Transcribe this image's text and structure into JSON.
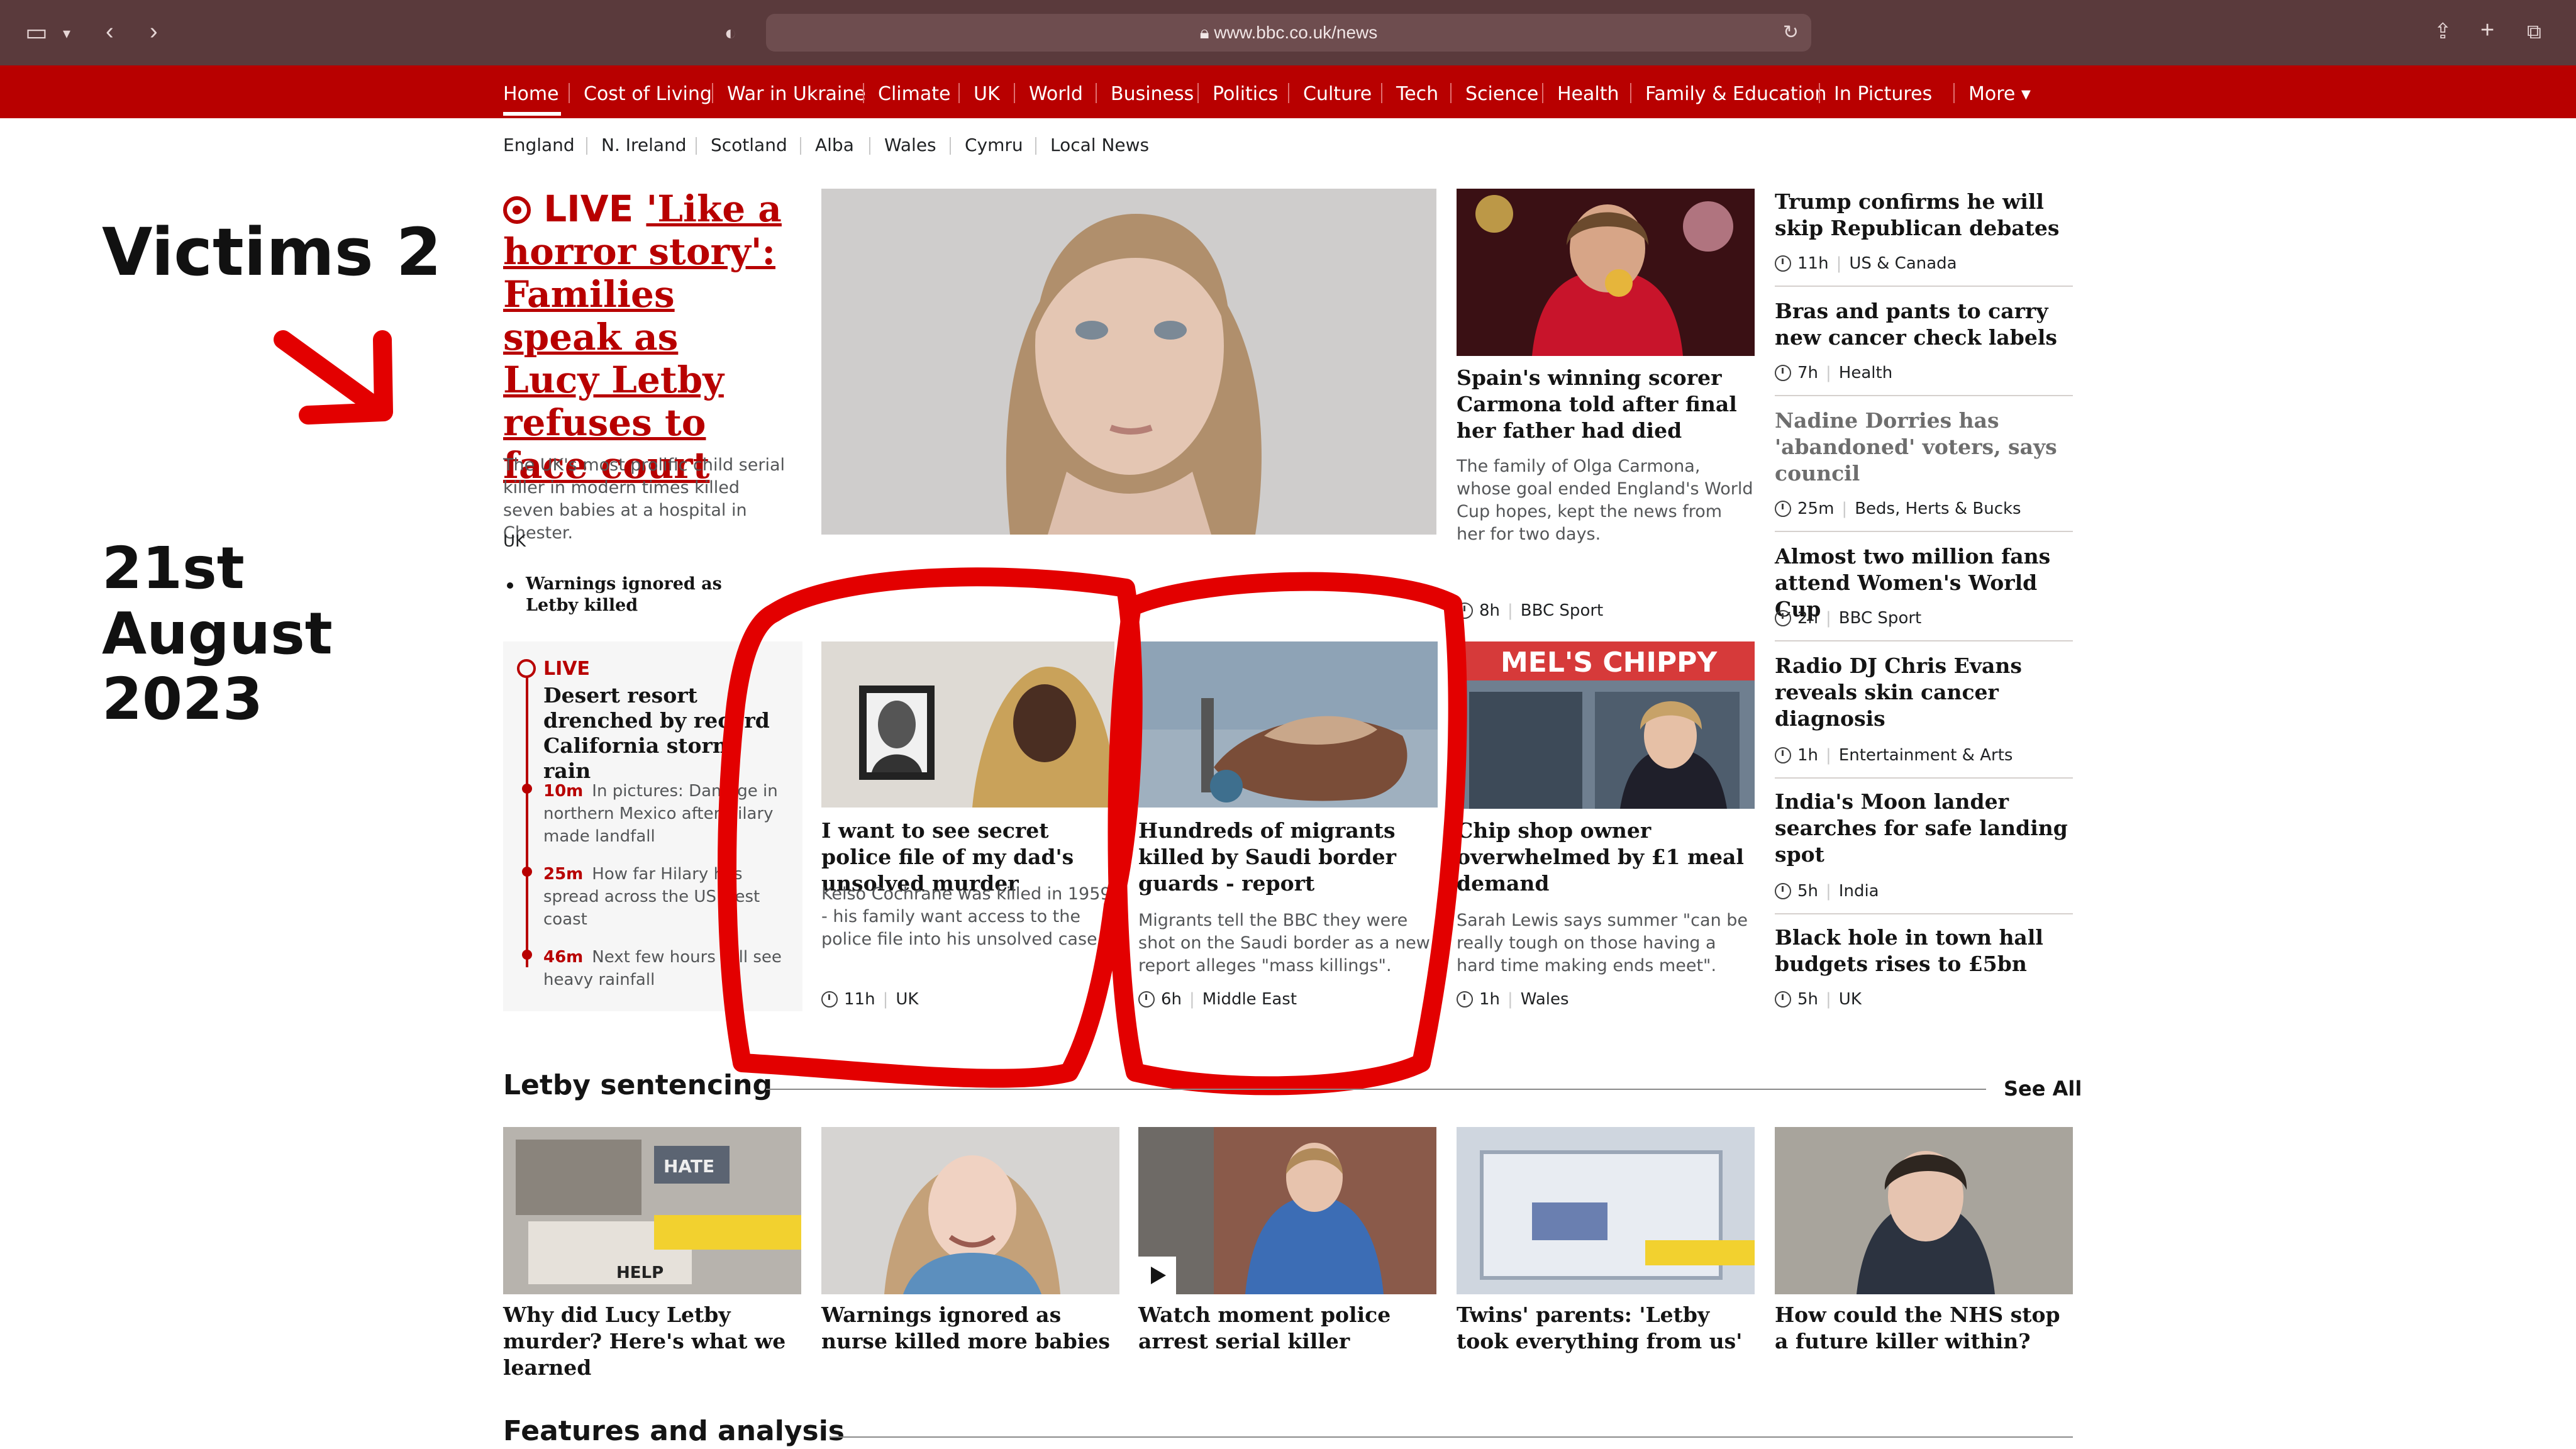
{
  "browser": {
    "url": "www.bbc.co.uk/news"
  },
  "nav": {
    "items": [
      "Home",
      "Cost of Living",
      "War in Ukraine",
      "Climate",
      "UK",
      "World",
      "Business",
      "Politics",
      "Culture",
      "Tech",
      "Science",
      "Health",
      "Family & Education",
      "In Pictures",
      "More ▾"
    ],
    "sub_items": [
      "England",
      "N. Ireland",
      "Scotland",
      "Alba",
      "Wales",
      "Cymru",
      "Local News"
    ]
  },
  "annotation": {
    "label": "Victims 2",
    "date": "21st August 2023",
    "marker_color": "#e30000"
  },
  "lead": {
    "live": "LIVE",
    "title": "'Like a horror story': Families speak as Lucy Letby refuses to face court",
    "summary": "The UK's most prolific child serial killer in modern times killed seven babies at a hospital in Chester.",
    "tag": "UK",
    "related": "Warnings ignored as Letby killed"
  },
  "live_box": {
    "live": "LIVE",
    "title": "Desert resort drenched by record California storm rain",
    "updates": [
      {
        "time": "10m",
        "text": "In pictures: Damage in northern Mexico after Hilary made landfall"
      },
      {
        "time": "25m",
        "text": "How far Hilary has spread across the US west coast"
      },
      {
        "time": "46m",
        "text": "Next few hours will see heavy rainfall"
      }
    ]
  },
  "stories": {
    "spain": {
      "title": "Spain's winning scorer Carmona told after final her father had died",
      "summary": "The family of Olga Carmona, whose goal ended England's World Cup hopes, kept the news from her for two days.",
      "time": "8h",
      "tag": "BBC Sport"
    },
    "cochrane": {
      "title": "I want to see secret police file of my dad's unsolved murder",
      "summary": "Kelso Cochrane was killed in 1959 - his family want access to the police file into his unsolved case.",
      "time": "11h",
      "tag": "UK"
    },
    "migrants": {
      "title": "Hundreds of migrants killed by Saudi border guards - report",
      "summary": "Migrants tell the BBC they were shot on the Saudi border as a new report alleges \"mass killings\".",
      "time": "6h",
      "tag": "Middle East"
    },
    "chippy": {
      "title": "Chip shop owner overwhelmed by £1 meal demand",
      "summary": "Sarah Lewis says summer \"can be really tough on those having a hard time making ends meet\".",
      "time": "1h",
      "tag": "Wales",
      "sign": "MEL'S CHIPPY"
    }
  },
  "right_column": [
    {
      "title": "Trump confirms he will skip Republican debates",
      "time": "11h",
      "tag": "US & Canada"
    },
    {
      "title": "Bras and pants to carry new cancer check labels",
      "time": "7h",
      "tag": "Health"
    },
    {
      "title": "Nadine Dorries has 'abandoned' voters, says council",
      "time": "25m",
      "tag": "Beds, Herts & Bucks"
    },
    {
      "title": "Almost two million fans attend Women's World Cup",
      "time": "2h",
      "tag": "BBC Sport"
    },
    {
      "title": "Radio DJ Chris Evans reveals skin cancer diagnosis",
      "time": "1h",
      "tag": "Entertainment & Arts"
    },
    {
      "title": "India's Moon lander searches for safe landing spot",
      "time": "5h",
      "tag": "India"
    },
    {
      "title": "Black hole in town hall budgets rises to £5bn",
      "time": "5h",
      "tag": "UK"
    }
  ],
  "letby_section": {
    "title": "Letby sentencing",
    "see_all": "See All",
    "cards": [
      {
        "title": "Why did Lucy Letby murder? Here's what we learned",
        "img_text_1": "HATE",
        "img_text_2": "HELP"
      },
      {
        "title": "Warnings ignored as nurse killed more babies"
      },
      {
        "title": "Watch moment police arrest serial killer"
      },
      {
        "title": "Twins' parents: 'Letby took everything from us'"
      },
      {
        "title": "How could the NHS stop a future killer within?"
      }
    ]
  },
  "features": {
    "title": "Features and analysis"
  }
}
